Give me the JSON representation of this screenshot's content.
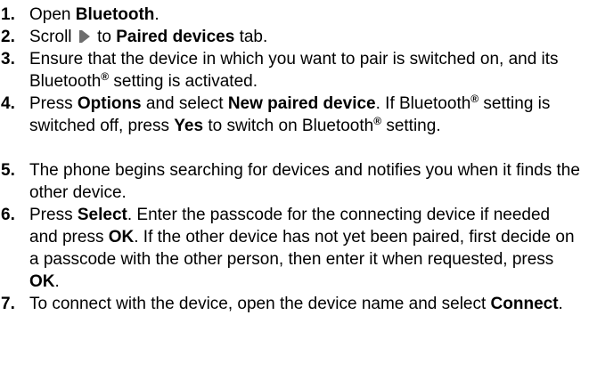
{
  "steps": [
    {
      "num": "1.",
      "p1": "Open ",
      "p2": "Bluetooth",
      "p3": "."
    },
    {
      "num": "2.",
      "p1": "Scroll",
      "p2": " to ",
      "p3": "Paired devices",
      "p4": " tab.",
      "icon": "scroll-right-icon"
    },
    {
      "num": "3.",
      "p1": "Ensure that the device in which you want to pair is switched on, and its Bluetooth",
      "reg": "®",
      "p2": " setting is activated."
    },
    {
      "num": "4.",
      "p1": "Press ",
      "p2": "Options",
      "p3": " and select ",
      "p4": "New paired device",
      "p5": ". If Bluetooth",
      "reg1": "®",
      "p6": " setting is switched off, press ",
      "p7": "Yes",
      "p8": " to switch on Bluetooth",
      "reg2": "®",
      "p9": " setting."
    },
    {
      "num": "5.",
      "p1": "The phone begins searching for devices and notifies you when it finds the other device."
    },
    {
      "num": "6.",
      "p1": "Press ",
      "p2": "Select",
      "p3": ". Enter the passcode for the connecting device if needed and press ",
      "p4": "OK",
      "p5": ". If the other device has not yet been paired, first decide on a passcode with the other person, then enter it when requested, press ",
      "p6": "OK",
      "p7": "."
    },
    {
      "num": "7.",
      "p1": "To connect with the device, open the device name and select ",
      "p2": "Connect",
      "p3": "."
    }
  ]
}
